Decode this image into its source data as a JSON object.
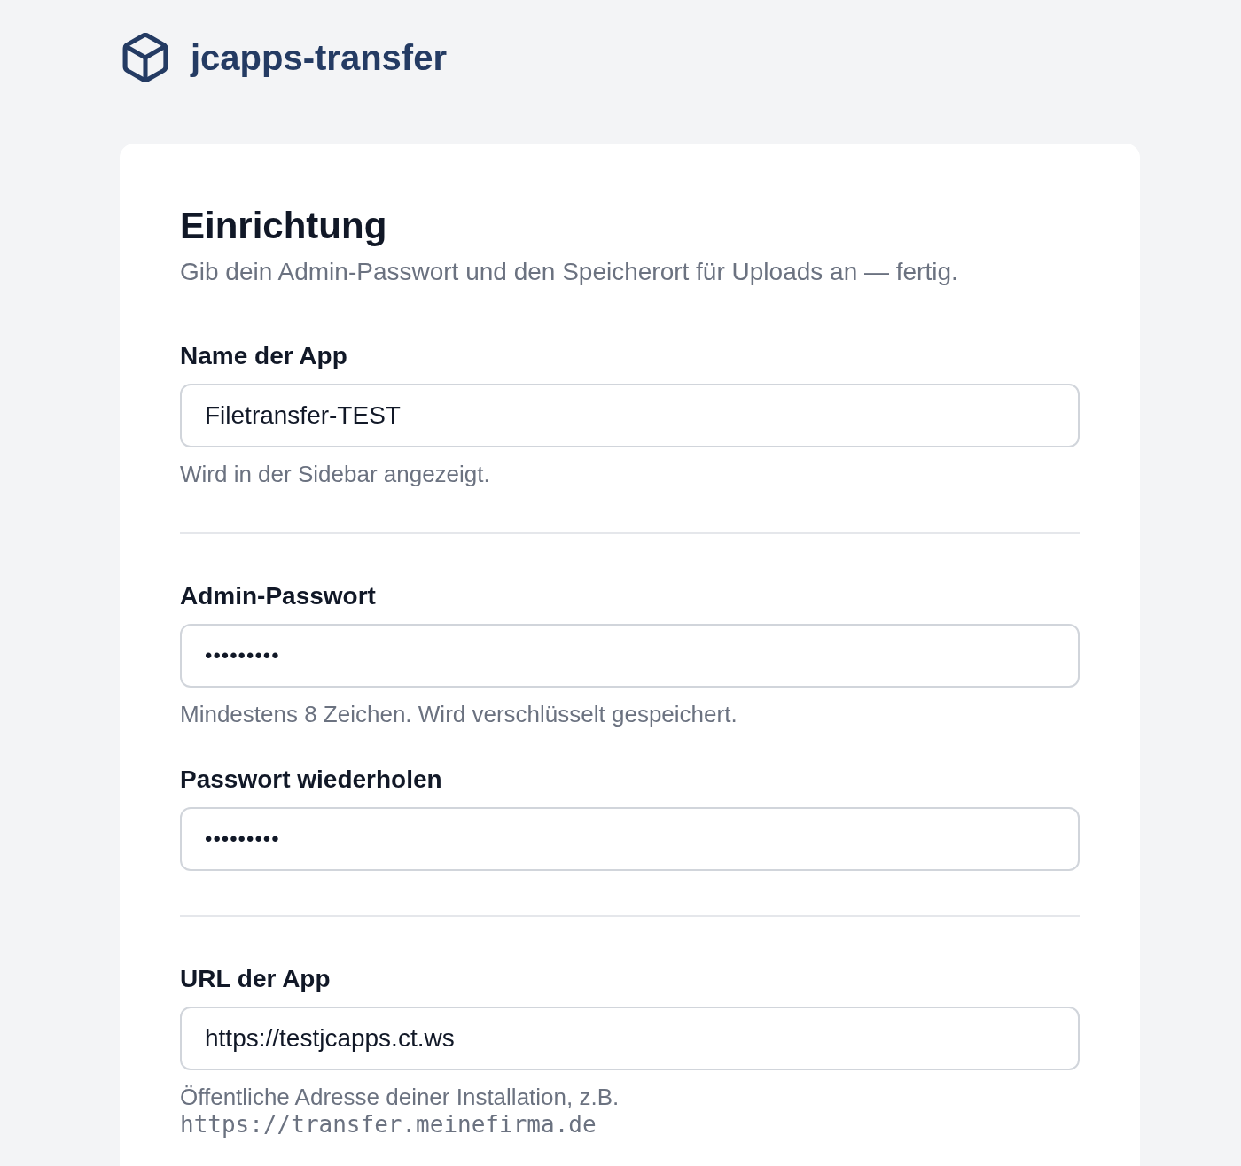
{
  "brand": {
    "name": "jcapps-transfer"
  },
  "setup": {
    "title": "Einrichtung",
    "subtitle": "Gib dein Admin-Passwort und den Speicherort für Uploads an — fertig."
  },
  "sections": [
    {
      "fields": [
        {
          "kind": "text",
          "label": "Name der App",
          "value": "Filetransfer-TEST",
          "hint": "Wird in der Sidebar angezeigt."
        }
      ]
    },
    {
      "fields": [
        {
          "kind": "password",
          "label": "Admin-Passwort",
          "value": "•••••••••",
          "hint": "Mindestens 8 Zeichen. Wird verschlüsselt gespeichert."
        },
        {
          "kind": "password",
          "label": "Passwort wiederholen",
          "value": "•••••••••"
        }
      ]
    },
    {
      "fields": [
        {
          "kind": "url",
          "label": "URL der App",
          "value": "https://testjcapps.ct.ws",
          "hint": "Öffentliche Adresse deiner Installation, z.B.",
          "hint_code": "https://transfer.meinefirma.de"
        }
      ]
    }
  ]
}
